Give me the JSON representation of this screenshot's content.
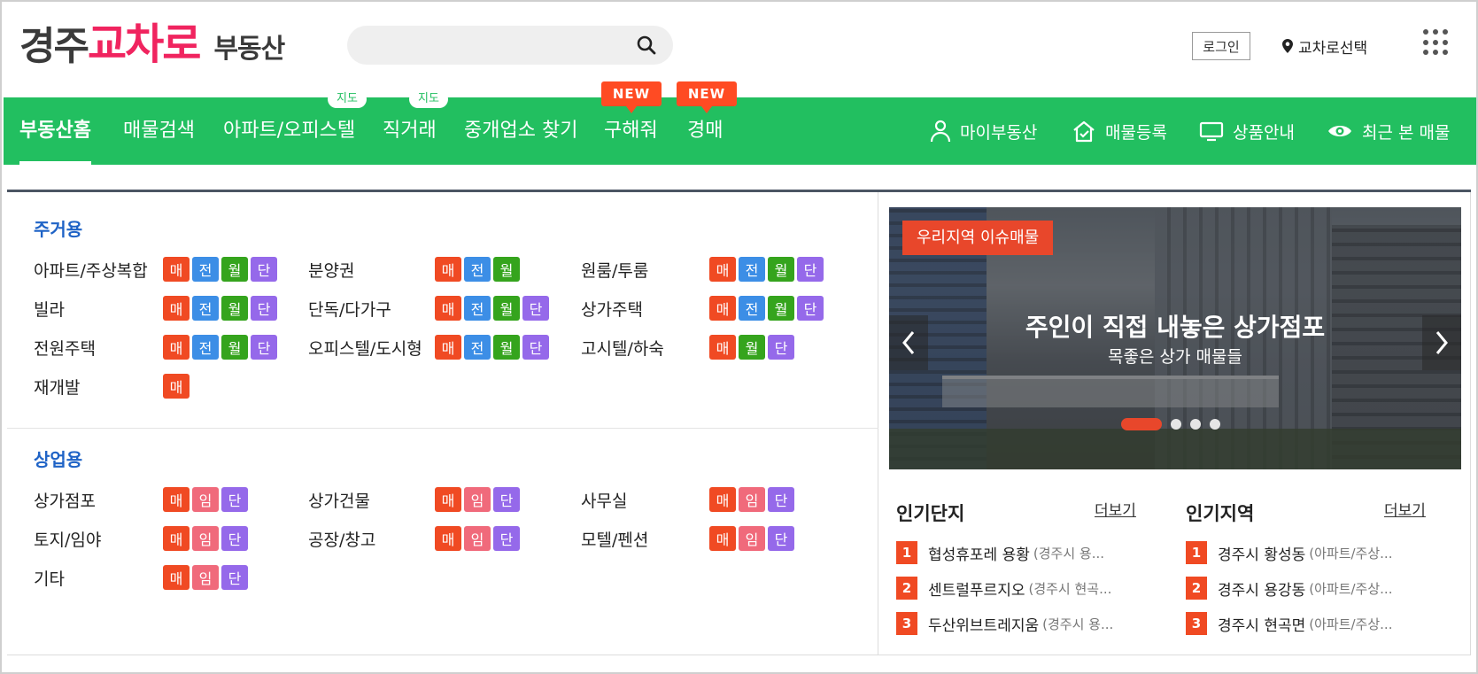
{
  "header": {
    "logo": {
      "part1": "경주",
      "part2": "교차로",
      "part3": "부동산"
    },
    "search": {
      "placeholder": ""
    },
    "login_label": "로그인",
    "region_label": "교차로선택"
  },
  "nav": {
    "items": [
      {
        "label": "부동산홈",
        "active": true
      },
      {
        "label": "매물검색"
      },
      {
        "label": "아파트/오피스텔",
        "tag": "지도"
      },
      {
        "label": "직거래",
        "tag": "지도"
      },
      {
        "label": "중개업소 찾기"
      },
      {
        "label": "구해줘",
        "tag": "NEW"
      },
      {
        "label": "경매",
        "tag": "NEW"
      }
    ],
    "right": [
      {
        "label": "마이부동산",
        "icon": "user-icon"
      },
      {
        "label": "매물등록",
        "icon": "house-check-icon"
      },
      {
        "label": "상품안내",
        "icon": "monitor-icon"
      },
      {
        "label": "최근 본 매물",
        "icon": "eye-icon"
      }
    ]
  },
  "residential": {
    "title": "주거용",
    "rows": [
      [
        {
          "label": "아파트/주상복합",
          "badges": [
            "매",
            "전",
            "월",
            "단"
          ]
        },
        {
          "label": "분양권",
          "badges": [
            "매",
            "전",
            "월"
          ]
        },
        {
          "label": "원룸/투룸",
          "badges": [
            "매",
            "전",
            "월",
            "단"
          ]
        }
      ],
      [
        {
          "label": "빌라",
          "badges": [
            "매",
            "전",
            "월",
            "단"
          ]
        },
        {
          "label": "단독/다가구",
          "badges": [
            "매",
            "전",
            "월",
            "단"
          ]
        },
        {
          "label": "상가주택",
          "badges": [
            "매",
            "전",
            "월",
            "단"
          ]
        }
      ],
      [
        {
          "label": "전원주택",
          "badges": [
            "매",
            "전",
            "월",
            "단"
          ]
        },
        {
          "label": "오피스텔/도시형",
          "badges": [
            "매",
            "전",
            "월",
            "단"
          ]
        },
        {
          "label": "고시텔/하숙",
          "badges": [
            "매",
            "월",
            "단"
          ]
        }
      ],
      [
        {
          "label": "재개발",
          "badges": [
            "매"
          ]
        }
      ]
    ]
  },
  "commercial": {
    "title": "상업용",
    "rows": [
      [
        {
          "label": "상가점포",
          "badges": [
            "매",
            "임",
            "단"
          ]
        },
        {
          "label": "상가건물",
          "badges": [
            "매",
            "임",
            "단"
          ]
        },
        {
          "label": "사무실",
          "badges": [
            "매",
            "임",
            "단"
          ]
        }
      ],
      [
        {
          "label": "토지/임야",
          "badges": [
            "매",
            "임",
            "단"
          ]
        },
        {
          "label": "공장/창고",
          "badges": [
            "매",
            "임",
            "단"
          ]
        },
        {
          "label": "모텔/펜션",
          "badges": [
            "매",
            "임",
            "단"
          ]
        }
      ],
      [
        {
          "label": "기타",
          "badges": [
            "매",
            "임",
            "단"
          ]
        }
      ]
    ]
  },
  "banner": {
    "tag": "우리지역 이슈매물",
    "title": "주인이 직접 내놓은 상가점포",
    "subtitle": "목좋은 상가 매물들",
    "slides": 4,
    "active_slide": 1
  },
  "popular_complex": {
    "title": "인기단지",
    "more": "더보기",
    "items": [
      {
        "rank": "1",
        "name": "협성휴포레 용황",
        "sub": "(경주시 용..."
      },
      {
        "rank": "2",
        "name": "센트럴푸르지오",
        "sub": "(경주시 현곡..."
      },
      {
        "rank": "3",
        "name": "두산위브트레지움",
        "sub": "(경주시 용..."
      }
    ]
  },
  "popular_area": {
    "title": "인기지역",
    "more": "더보기",
    "items": [
      {
        "rank": "1",
        "name": "경주시 황성동",
        "sub": "(아파트/주상..."
      },
      {
        "rank": "2",
        "name": "경주시 용강동",
        "sub": "(아파트/주상..."
      },
      {
        "rank": "3",
        "name": "경주시 현곡면",
        "sub": "(아파트/주상..."
      }
    ]
  },
  "colors": {
    "brand_green": "#22bf60",
    "brand_pink": "#f0245f",
    "section_blue": "#1f63c6",
    "badge_sale": "#f04a23",
    "badge_jeonse": "#3c8ee6",
    "badge_monthly": "#35a41d",
    "badge_short": "#9569ea",
    "badge_lease": "#f06a7b"
  }
}
